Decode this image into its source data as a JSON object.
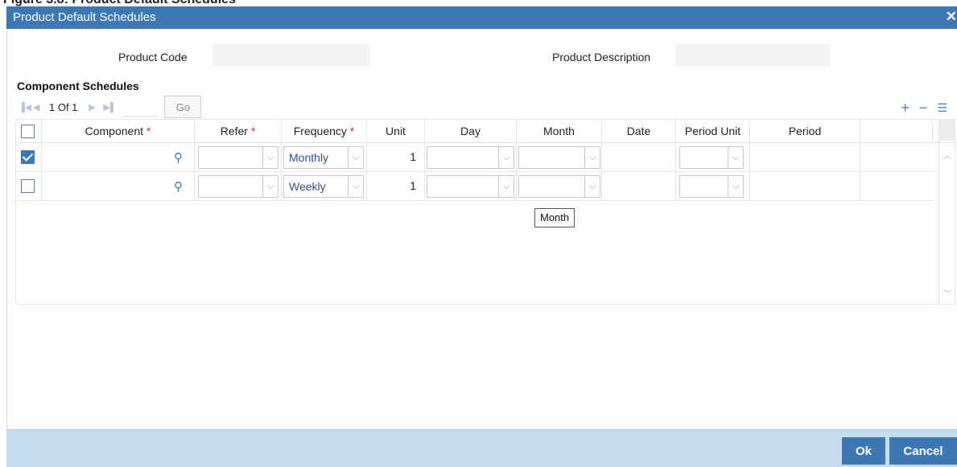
{
  "window": {
    "heading": "Figure 3.8: Product Default Schedules",
    "title": "Product Default Schedules",
    "close_glyph": "✕"
  },
  "fields": {
    "product_code_label": "Product Code",
    "product_code_value": "",
    "product_description_label": "Product Description",
    "product_description_value": ""
  },
  "section": {
    "title": "Component Schedules"
  },
  "pager": {
    "page_text": "1 Of 1",
    "go_label": "Go"
  },
  "toolbar": {
    "add_glyph": "+",
    "remove_glyph": "−",
    "view_glyph": "☰"
  },
  "table": {
    "columns": {
      "component": "Component",
      "refer": "Refer",
      "frequency": "Frequency",
      "unit": "Unit",
      "day": "Day",
      "month": "Month",
      "date": "Date",
      "period_unit": "Period Unit",
      "period": "Period"
    },
    "required_mark": "*",
    "rows": [
      {
        "checked": true,
        "component": "",
        "refer": "",
        "frequency": "Monthly",
        "unit": "1",
        "day": "",
        "month": "",
        "date": "",
        "period_unit": "",
        "period": ""
      },
      {
        "checked": false,
        "component": "",
        "refer": "",
        "frequency": "Weekly",
        "unit": "1",
        "day": "",
        "month": "",
        "date": "",
        "period_unit": "",
        "period": ""
      }
    ]
  },
  "tooltip": {
    "text": "Month"
  },
  "footer": {
    "ok_label": "Ok",
    "cancel_label": "Cancel"
  },
  "colors": {
    "titlebar": "#3e78b4",
    "footer": "#c5dbef",
    "button": "#3e78b4",
    "required": "#d32f2f"
  }
}
